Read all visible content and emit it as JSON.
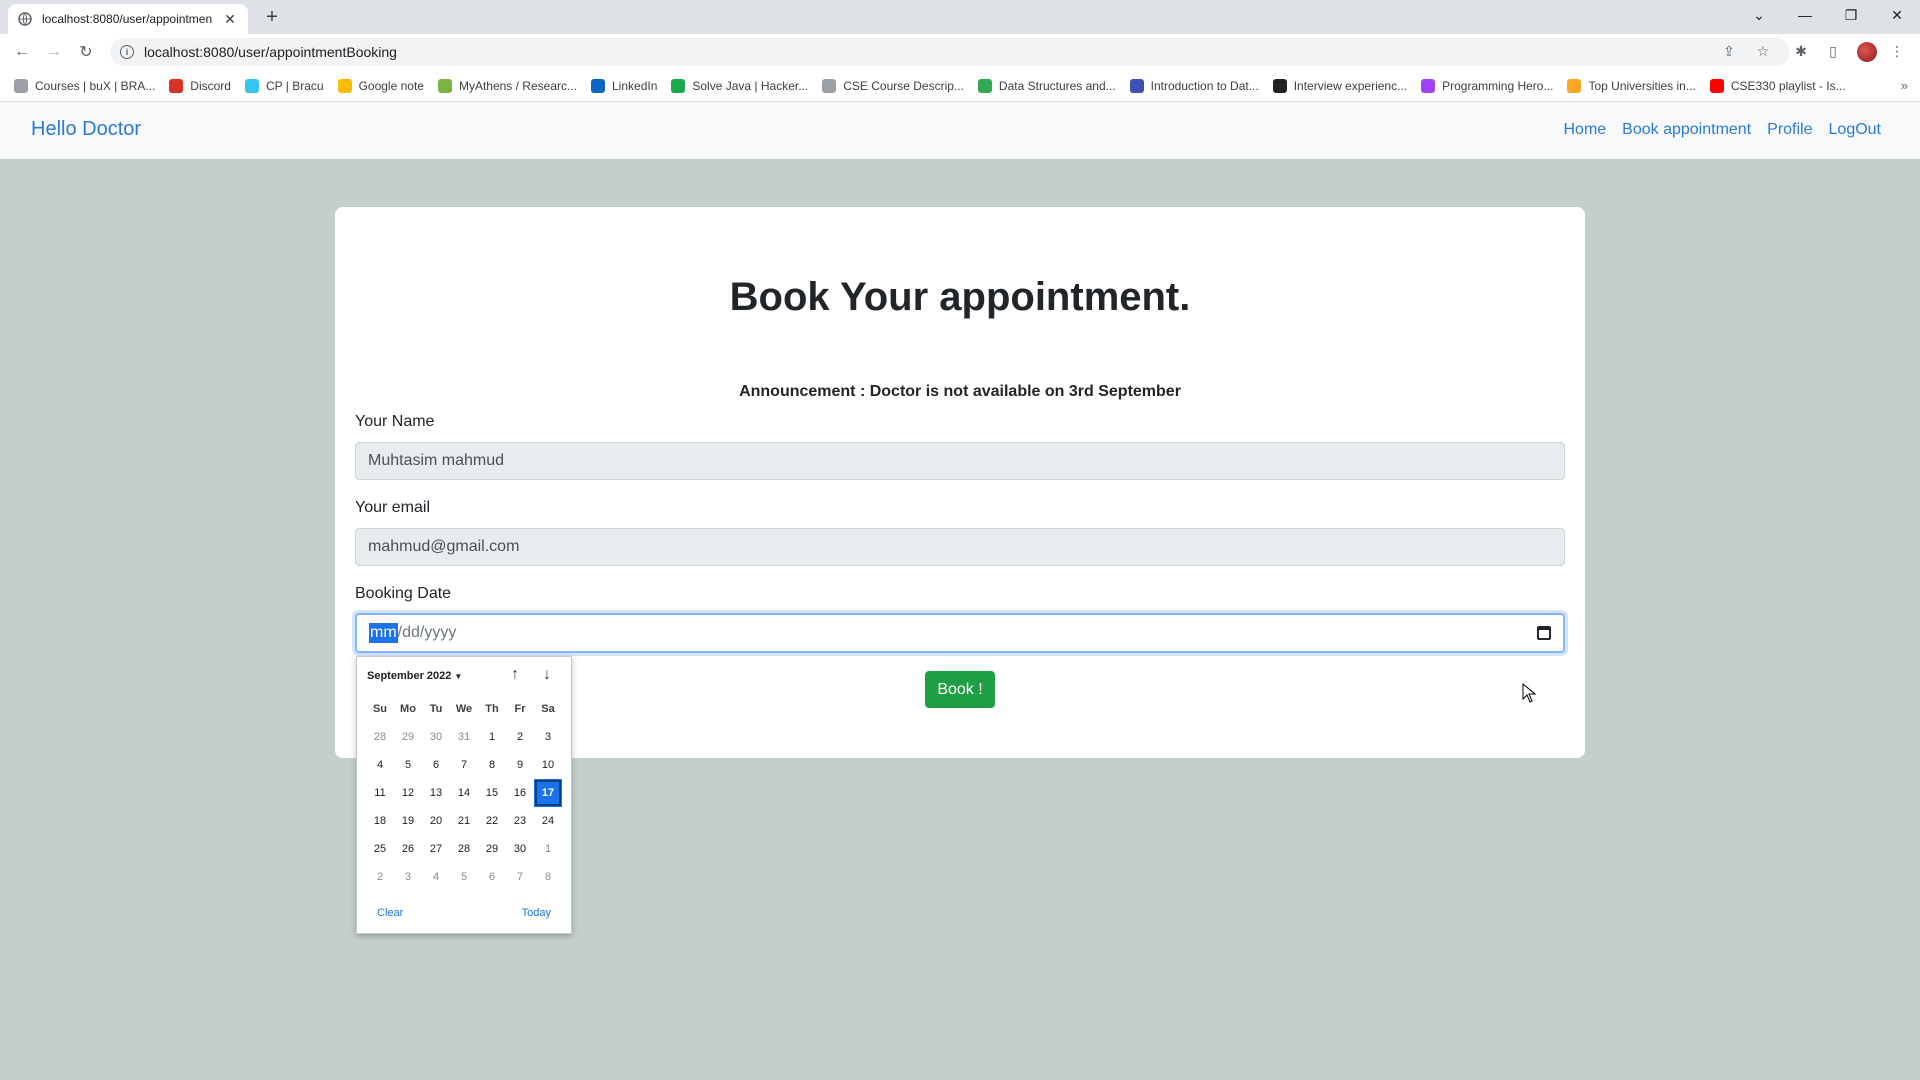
{
  "browser": {
    "tab_title": "localhost:8080/user/appointmen",
    "url": "localhost:8080/user/appointmentBooking",
    "bookmarks": [
      {
        "label": "Courses | buX | BRA...",
        "icon": "bux-icon",
        "color": "#9aa0a6"
      },
      {
        "label": "Discord",
        "icon": "discord-icon",
        "color": "#d93025"
      },
      {
        "label": "CP | Bracu",
        "icon": "slack-icon",
        "color": "#36c5f0"
      },
      {
        "label": "Google note",
        "icon": "keep-icon",
        "color": "#fbbc04"
      },
      {
        "label": "MyAthens / Researc...",
        "icon": "myathens-icon",
        "color": "#7cb342"
      },
      {
        "label": "LinkedIn",
        "icon": "linkedin-icon",
        "color": "#0a66c2"
      },
      {
        "label": "Solve Java | Hacker...",
        "icon": "hackerrank-icon",
        "color": "#1ba94c"
      },
      {
        "label": "CSE Course Descrip...",
        "icon": "cse-icon",
        "color": "#9aa0a6"
      },
      {
        "label": "Data Structures and...",
        "icon": "ds-icon",
        "color": "#34a853"
      },
      {
        "label": "Introduction to Dat...",
        "icon": "intro-icon",
        "color": "#3f51b5"
      },
      {
        "label": "Interview experienc...",
        "icon": "interview-icon",
        "color": "#202124"
      },
      {
        "label": "Programming Hero...",
        "icon": "programming-hero-icon",
        "color": "#a142f4"
      },
      {
        "label": "Top Universities in...",
        "icon": "topuni-icon",
        "color": "#f9a825"
      },
      {
        "label": "CSE330 playlist - Is...",
        "icon": "youtube-icon",
        "color": "#ff0000"
      }
    ]
  },
  "navbar": {
    "brand": "Hello Doctor",
    "links": [
      "Home",
      "Book appointment",
      "Profile",
      "LogOut"
    ]
  },
  "form": {
    "title": "Book Your appointment.",
    "announcement": "Announcement : Doctor is not available on 3rd September",
    "name_label": "Your Name",
    "name_value": "Muhtasim mahmud",
    "email_label": "Your email",
    "email_value": "mahmud@gmail.com",
    "date_label": "Booking Date",
    "date_mm": "mm",
    "date_rest": "/dd/yyyy",
    "book_button": "Book !"
  },
  "picker": {
    "month_label": "September 2022",
    "weekdays": [
      "Su",
      "Mo",
      "Tu",
      "We",
      "Th",
      "Fr",
      "Sa"
    ],
    "days": [
      [
        "28",
        "29",
        "30",
        "31",
        "1",
        "2",
        "3"
      ],
      [
        "4",
        "5",
        "6",
        "7",
        "8",
        "9",
        "10"
      ],
      [
        "11",
        "12",
        "13",
        "14",
        "15",
        "16",
        "17"
      ],
      [
        "18",
        "19",
        "20",
        "21",
        "22",
        "23",
        "24"
      ],
      [
        "25",
        "26",
        "27",
        "28",
        "29",
        "30",
        "1"
      ],
      [
        "2",
        "3",
        "4",
        "5",
        "6",
        "7",
        "8"
      ]
    ],
    "today_value": "17",
    "clear_label": "Clear",
    "today_label": "Today"
  },
  "colors": {
    "brand_blue": "#2b7bd6",
    "book_green": "#1e9e45",
    "page_bg": "#c4cfcb",
    "selected_day": "#1a73e8"
  }
}
